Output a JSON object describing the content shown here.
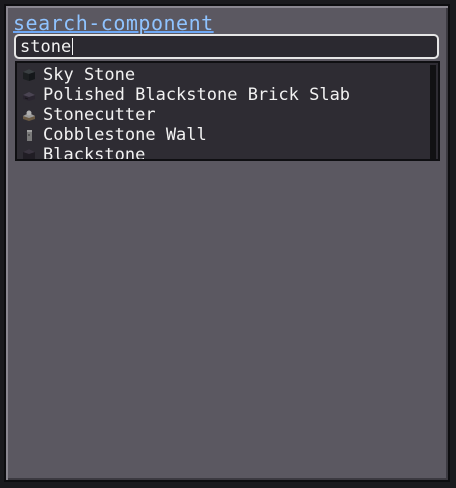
{
  "title": "search-component",
  "search": {
    "value": "stone",
    "placeholder": ""
  },
  "results": [
    {
      "label": "Sky Stone",
      "icon": "sky-stone-icon"
    },
    {
      "label": "Polished Blackstone Brick Slab",
      "icon": "polished-blackstone-brick-slab-icon"
    },
    {
      "label": "Stonecutter",
      "icon": "stonecutter-icon"
    },
    {
      "label": "Cobblestone Wall",
      "icon": "cobblestone-wall-icon"
    },
    {
      "label": "Blackstone",
      "icon": "blackstone-icon"
    }
  ]
}
